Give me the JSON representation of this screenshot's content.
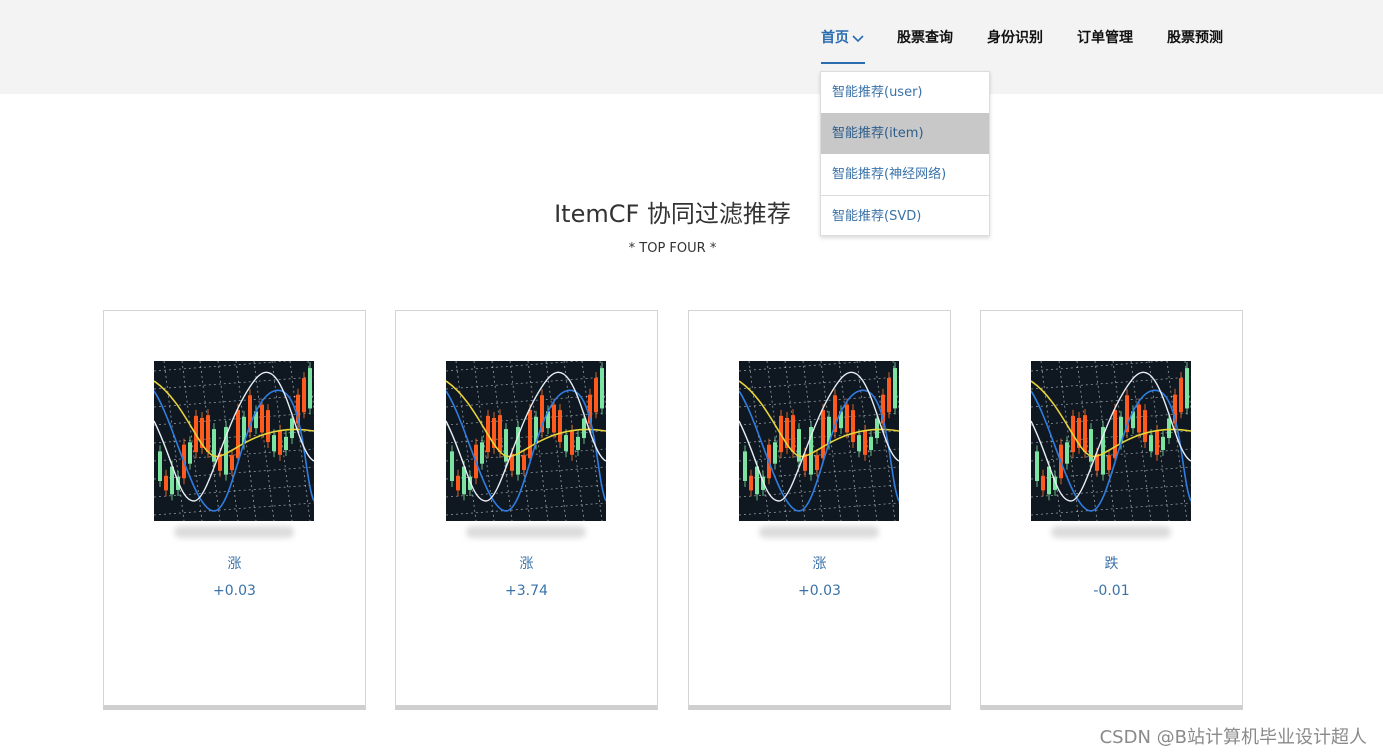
{
  "nav": {
    "items": [
      {
        "label": "首页",
        "active": true
      },
      {
        "label": "股票查询"
      },
      {
        "label": "身份识别"
      },
      {
        "label": "订单管理"
      },
      {
        "label": "股票预测"
      }
    ]
  },
  "dropdown": {
    "items": [
      {
        "label": "智能推荐(user)"
      },
      {
        "label": "智能推荐(item)",
        "highlighted": true
      },
      {
        "label": "智能推荐(神经网络)"
      },
      {
        "label": "智能推荐(SVD)"
      }
    ]
  },
  "main": {
    "title": "ItemCF 协同过滤推荐",
    "subtitle": "* TOP FOUR *"
  },
  "cards": [
    {
      "trend": "涨",
      "change": "+0.03"
    },
    {
      "trend": "涨",
      "change": "+3.74"
    },
    {
      "trend": "涨",
      "change": "+0.03"
    },
    {
      "trend": "跌",
      "change": "-0.01"
    }
  ],
  "watermark": "CSDN @B站计算机毕业设计超人",
  "colors": {
    "accent": "#2b6cb0",
    "link": "#3a72a8",
    "header_bg": "#f3f3f3",
    "dropdown_highlight": "#c8c8c8"
  }
}
